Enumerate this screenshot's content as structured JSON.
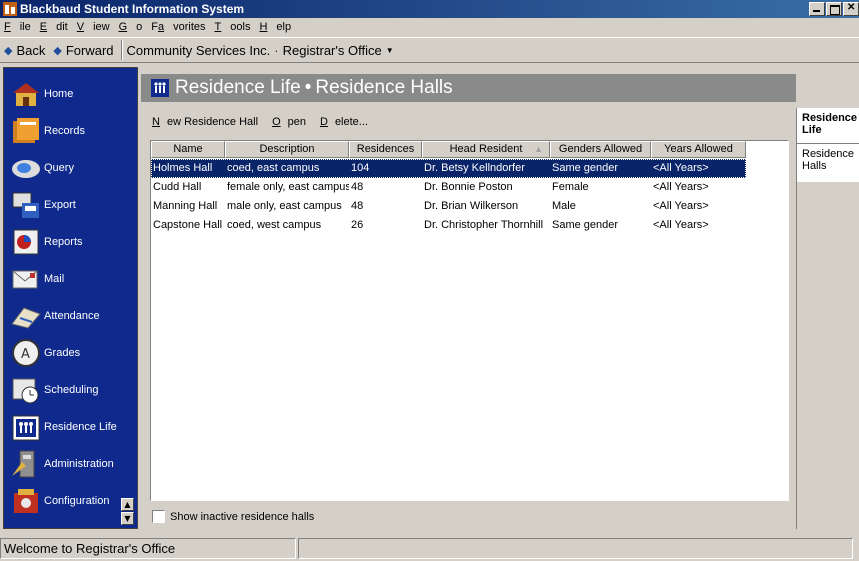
{
  "window": {
    "title": "Blackbaud Student Information System"
  },
  "menu": [
    "File",
    "Edit",
    "View",
    "Go",
    "Favorites",
    "Tools",
    "Help"
  ],
  "nav": {
    "back": "Back",
    "forward": "Forward",
    "org": "Community Services Inc.",
    "office": "Registrar's Office"
  },
  "sidebar": {
    "items": [
      {
        "label": "Home",
        "icon": "home-icon"
      },
      {
        "label": "Records",
        "icon": "records-icon"
      },
      {
        "label": "Query",
        "icon": "query-icon"
      },
      {
        "label": "Export",
        "icon": "export-icon"
      },
      {
        "label": "Reports",
        "icon": "reports-icon"
      },
      {
        "label": "Mail",
        "icon": "mail-icon"
      },
      {
        "label": "Attendance",
        "icon": "attendance-icon"
      },
      {
        "label": "Grades",
        "icon": "grades-icon"
      },
      {
        "label": "Scheduling",
        "icon": "scheduling-icon"
      },
      {
        "label": "Residence Life",
        "icon": "residence-life-icon"
      },
      {
        "label": "Administration",
        "icon": "administration-icon"
      },
      {
        "label": "Configuration",
        "icon": "configuration-icon"
      }
    ]
  },
  "header": {
    "section": "Residence Life",
    "page": "Residence Halls"
  },
  "toolbar": {
    "new_label": "New Residence Hall",
    "open_label": "Open",
    "delete_label": "Delete..."
  },
  "table": {
    "columns": [
      "Name",
      "Description",
      "Residences",
      "Head Resident",
      "Genders Allowed",
      "Years Allowed"
    ],
    "sorted_column": "Head Resident",
    "rows": [
      [
        "Holmes Hall",
        "coed, east campus",
        "104",
        "Dr. Betsy Kellndorfer",
        "Same gender",
        "<All Years>"
      ],
      [
        "Cudd Hall",
        "female only, east campus",
        "48",
        "Dr. Bonnie Poston",
        "Female",
        "<All Years>"
      ],
      [
        "Manning Hall",
        "male only, east campus",
        "48",
        "Dr. Brian Wilkerson",
        "Male",
        "<All Years>"
      ],
      [
        "Capstone Hall",
        "coed, west campus",
        "26",
        "Dr. Christopher Thornhill",
        "Same gender",
        "<All Years>"
      ]
    ],
    "selected_row": 0
  },
  "inactive_checkbox": {
    "label": "Show inactive residence halls",
    "checked": false
  },
  "right_panel": {
    "title": "Residence Life",
    "item": "Residence Halls"
  },
  "status": {
    "text": "Welcome to Registrar's Office"
  }
}
